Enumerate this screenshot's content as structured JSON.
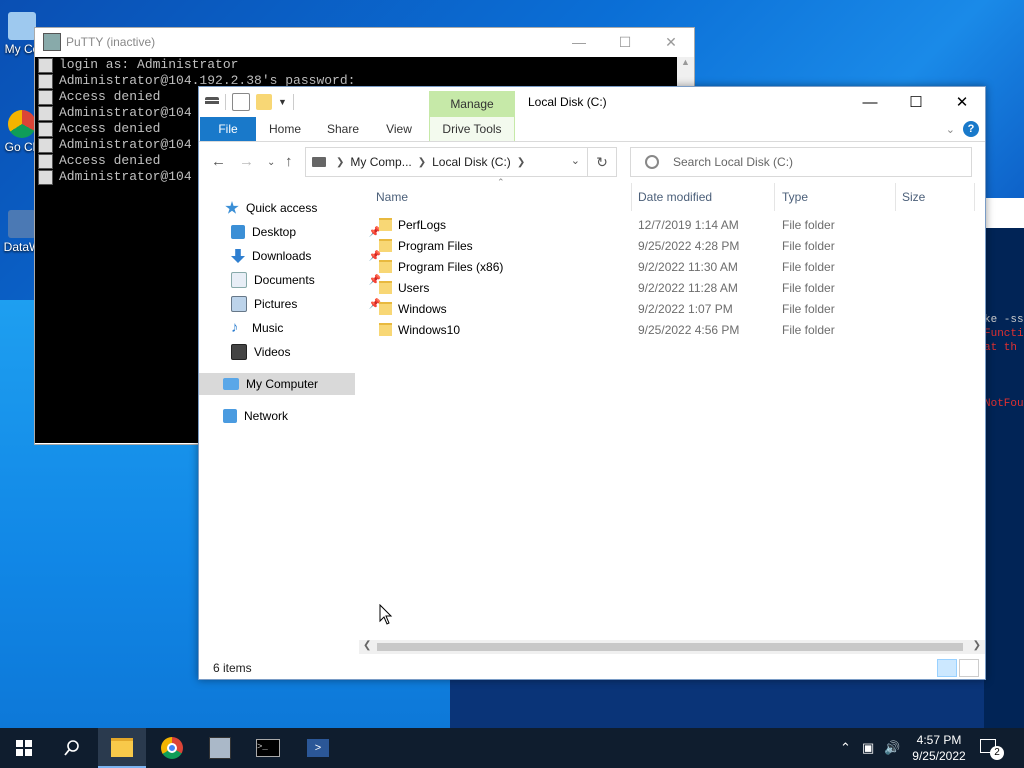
{
  "desktop": {
    "icons": [
      {
        "label": "My Co"
      },
      {
        "label": "Go Ch"
      },
      {
        "label": "DataW"
      }
    ],
    "bg_console_lines": [
      "ke -ss",
      "Functi",
      "at th",
      "NotFou"
    ]
  },
  "putty": {
    "title": "PuTTY (inactive)",
    "lines": [
      "login as: Administrator",
      "Administrator@104.192.2.38's password:",
      "Access denied",
      "Administrator@104",
      "Access denied",
      "Administrator@104",
      "Access denied",
      "Administrator@104"
    ]
  },
  "explorer": {
    "title": "Local Disk (C:)",
    "manage_label": "Manage",
    "tabs": [
      "File",
      "Home",
      "Share",
      "View",
      "Drive Tools"
    ],
    "address": {
      "crumb1": "My Comp...",
      "crumb2": "Local Disk (C:)"
    },
    "search_placeholder": "Search Local Disk (C:)",
    "nav": {
      "quick_access": "Quick access",
      "items": [
        "Desktop",
        "Downloads",
        "Documents",
        "Pictures",
        "Music",
        "Videos"
      ],
      "my_computer": "My Computer",
      "network": "Network"
    },
    "columns": {
      "name": "Name",
      "date": "Date modified",
      "type": "Type",
      "size": "Size"
    },
    "files": [
      {
        "name": "PerfLogs",
        "date": "12/7/2019 1:14 AM",
        "type": "File folder"
      },
      {
        "name": "Program Files",
        "date": "9/25/2022 4:28 PM",
        "type": "File folder"
      },
      {
        "name": "Program Files (x86)",
        "date": "9/2/2022 11:30 AM",
        "type": "File folder"
      },
      {
        "name": "Users",
        "date": "9/2/2022 11:28 AM",
        "type": "File folder"
      },
      {
        "name": "Windows",
        "date": "9/2/2022 1:07 PM",
        "type": "File folder"
      },
      {
        "name": "Windows10",
        "date": "9/25/2022 4:56 PM",
        "type": "File folder"
      }
    ],
    "status": "6 items"
  },
  "taskbar": {
    "time": "4:57 PM",
    "date": "9/25/2022",
    "notifications": "2"
  }
}
